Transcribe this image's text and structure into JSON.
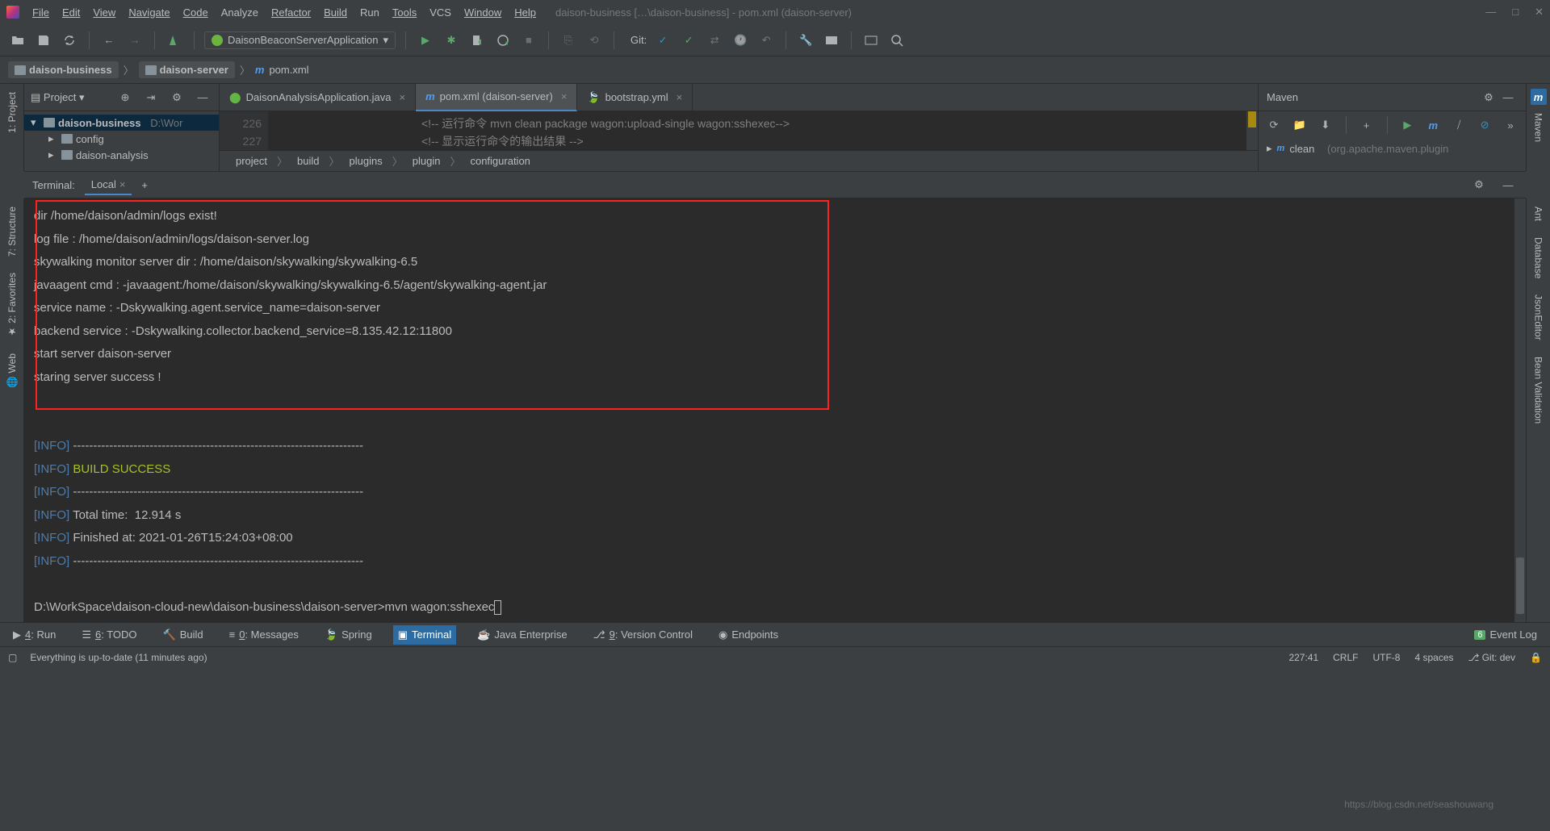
{
  "window": {
    "title": "daison-business […\\daison-business] - pom.xml (daison-server)"
  },
  "menu": {
    "file": "File",
    "edit": "Edit",
    "view": "View",
    "navigate": "Navigate",
    "code": "Code",
    "analyze": "Analyze",
    "refactor": "Refactor",
    "build": "Build",
    "run": "Run",
    "tools": "Tools",
    "vcs": "VCS",
    "window": "Window",
    "help": "Help"
  },
  "run_config": "DaisonBeaconServerApplication",
  "git_label": "Git:",
  "breadcrumb": {
    "b1": "daison-business",
    "b2": "daison-server",
    "b3": "pom.xml"
  },
  "project": {
    "tab": "Project",
    "root": "daison-business",
    "root_path": "D:\\Wor",
    "c1": "config",
    "c2": "daison-analysis"
  },
  "left_tabs": {
    "project": "1: Project",
    "structure": "7: Structure",
    "favorites": "2: Favorites",
    "web": "Web"
  },
  "right_tabs": {
    "maven": "Maven",
    "ant": "Ant",
    "database": "Database",
    "json": "JsonEditor",
    "bean": "Bean Validation"
  },
  "editor_tabs": {
    "t1": "DaisonAnalysisApplication.java",
    "t2": "pom.xml (daison-server)",
    "t3": "bootstrap.yml"
  },
  "editor": {
    "ln226": "226",
    "ln227": "227",
    "line1": "<!-- 运行命令 mvn clean package wagon:upload-single wagon:sshexec-->",
    "line2": "<!-- 显示运行命令的输出结果  -->"
  },
  "code_crumb": {
    "p1": "project",
    "p2": "build",
    "p3": "plugins",
    "p4": "plugin",
    "p5": "configuration"
  },
  "maven": {
    "title": "Maven",
    "node": "clean",
    "node_detail": "(org.apache.maven.plugin"
  },
  "terminal": {
    "title": "Terminal:",
    "tab": "Local",
    "lines_plain": [
      "dir /home/daison/admin/logs exist!",
      "log file : /home/daison/admin/logs/daison-server.log",
      "skywalking monitor server dir : /home/daison/skywalking/skywalking-6.5",
      "javaagent cmd : -javaagent:/home/daison/skywalking/skywalking-6.5/agent/skywalking-agent.jar",
      "service name : -Dskywalking.agent.service_name=daison-server",
      "backend service : -Dskywalking.collector.backend_service=8.135.42.12:11800",
      "start server daison-server",
      "staring server success !"
    ],
    "info_dashes": "------------------------------------------------------------------------",
    "build_success": "BUILD SUCCESS",
    "total_time": "Total time:  12.914 s",
    "finished": "Finished at: 2021-01-26T15:24:03+08:00",
    "prompt": "D:\\WorkSpace\\daison-cloud-new\\daison-business\\daison-server>mvn wagon:sshexec"
  },
  "bottom_tabs": {
    "run": "4: Run",
    "todo": "6: TODO",
    "build": "Build",
    "messages": "0: Messages",
    "spring": "Spring",
    "terminal": "Terminal",
    "java_ee": "Java Enterprise",
    "vc": "9: Version Control",
    "endpoints": "Endpoints",
    "eventlog": "Event Log"
  },
  "status": {
    "msg": "Everything is up-to-date (11 minutes ago)",
    "pos": "227:41",
    "sep": "CRLF",
    "enc": "UTF-8",
    "indent": "4 spaces",
    "branch": "Git: dev"
  },
  "watermark": "https://blog.csdn.net/seashouwang",
  "eventlog_badge": "6"
}
